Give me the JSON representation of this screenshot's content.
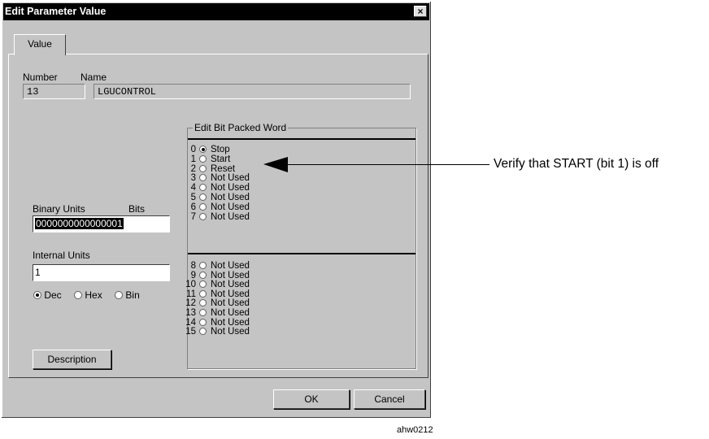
{
  "dialog": {
    "title": "Edit Parameter Value",
    "close_glyph": "×",
    "tab_label": "Value",
    "number_label": "Number",
    "number_value": "13",
    "name_label": "Name",
    "name_value": "LGUCONTROL",
    "binary_units_label": "Binary Units",
    "bits_label": "Bits",
    "binary_value": "0000000000000001",
    "internal_units_label": "Internal Units",
    "internal_value": "1",
    "format_options": [
      {
        "label": "Dec",
        "selected": true
      },
      {
        "label": "Hex",
        "selected": false
      },
      {
        "label": "Bin",
        "selected": false
      }
    ],
    "description_button": "Description",
    "ok_button": "OK",
    "cancel_button": "Cancel"
  },
  "bit_group": {
    "title": "Edit Bit Packed Word",
    "bits": [
      {
        "num": "0",
        "label": "Stop",
        "on": true
      },
      {
        "num": "1",
        "label": "Start",
        "on": false
      },
      {
        "num": "2",
        "label": "Reset",
        "on": false
      },
      {
        "num": "3",
        "label": "Not Used",
        "on": false
      },
      {
        "num": "4",
        "label": "Not Used",
        "on": false
      },
      {
        "num": "5",
        "label": "Not Used",
        "on": false
      },
      {
        "num": "6",
        "label": "Not Used",
        "on": false
      },
      {
        "num": "7",
        "label": "Not Used",
        "on": false
      },
      {
        "num": "8",
        "label": "Not Used",
        "on": false
      },
      {
        "num": "9",
        "label": "Not Used",
        "on": false
      },
      {
        "num": "10",
        "label": "Not Used",
        "on": false
      },
      {
        "num": "11",
        "label": "Not Used",
        "on": false
      },
      {
        "num": "12",
        "label": "Not Used",
        "on": false
      },
      {
        "num": "13",
        "label": "Not Used",
        "on": false
      },
      {
        "num": "14",
        "label": "Not Used",
        "on": false
      },
      {
        "num": "15",
        "label": "Not Used",
        "on": false
      }
    ]
  },
  "annotation": {
    "callout": "Verify that START (bit 1) is off",
    "figure_id": "ahw0212"
  }
}
